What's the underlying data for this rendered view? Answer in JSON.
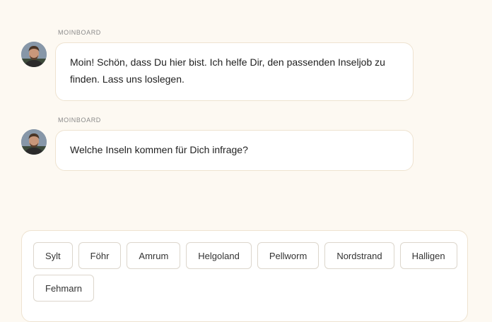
{
  "messages": [
    {
      "sender": "MOINBOARD",
      "text": "Moin! Schön, dass Du hier bist. Ich helfe Dir, den passenden Inseljob zu finden. Lass uns loslegen."
    },
    {
      "sender": "MOINBOARD",
      "text": "Welche Inseln kommen für Dich infrage?"
    }
  ],
  "choices": [
    "Sylt",
    "Föhr",
    "Amrum",
    "Helgoland",
    "Pellworm",
    "Nordstrand",
    "Halligen",
    "Fehmarn"
  ],
  "colors": {
    "background": "#fdf9f2",
    "bubble": "#ffffff",
    "border": "#eee3d0"
  },
  "icons": {
    "avatar": "bot-avatar-photo"
  }
}
